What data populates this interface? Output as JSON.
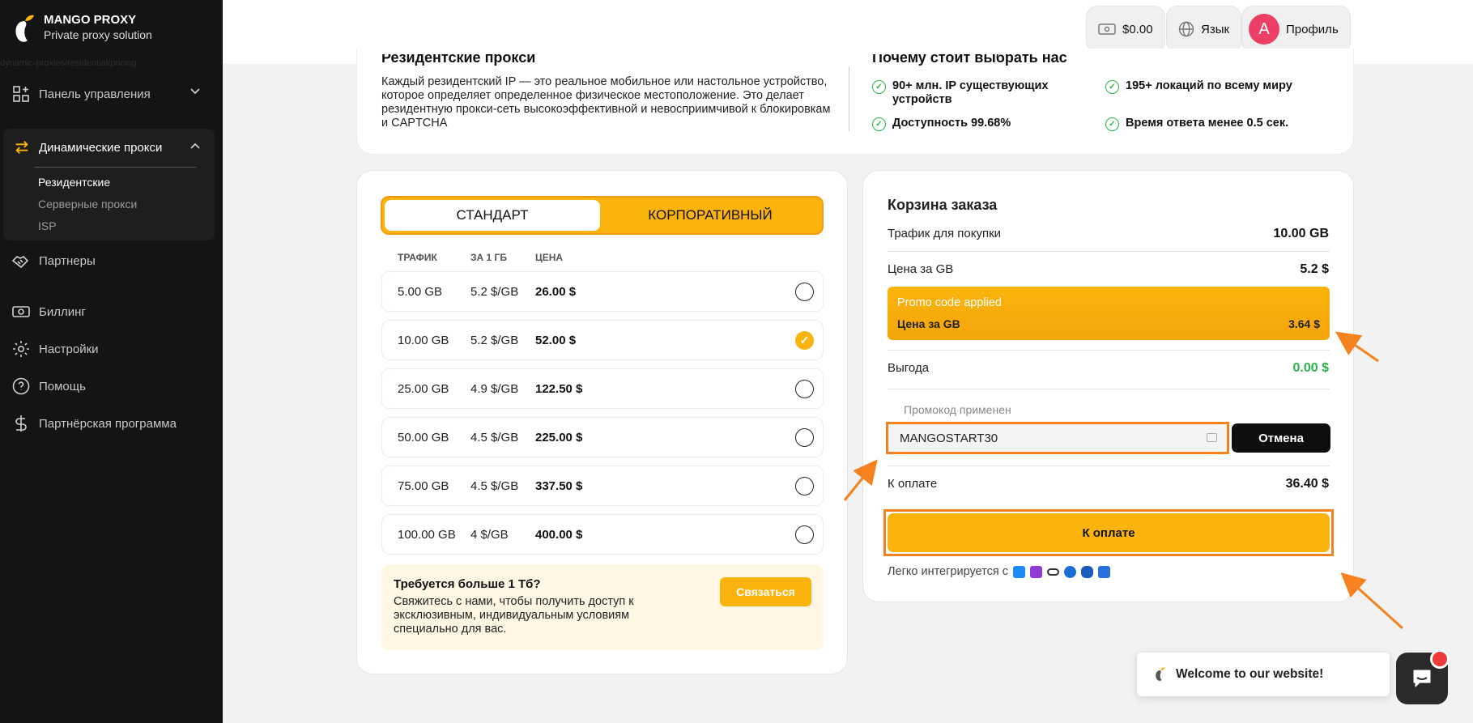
{
  "brand": {
    "name": "MANGO PROXY",
    "tagline": "Private proxy solution",
    "url_ghost": "dynamic-proxies/residential/pricing"
  },
  "sidebar": {
    "dashboard": "Панель управления",
    "dynamic_group": {
      "label": "Динамические прокси",
      "items": [
        "Резидентские",
        "Серверные прокси",
        "ISP"
      ]
    },
    "partners": "Партнеры",
    "billing": "Биллинг",
    "settings": "Настройки",
    "help": "Помощь",
    "affiliate": "Партнёрская программа"
  },
  "topbar": {
    "balance": "$0.00",
    "language": "Язык",
    "avatar_letter": "A",
    "profile": "Профиль"
  },
  "info": {
    "title_left": "Резидентские прокси",
    "title_right": "Почему стоит выбрать нас",
    "description": "Каждый резидентский IP — это реальное мобильное или настольное устройство, которое определяет определенное физическое местоположение. Это делает резидентную прокси-сеть высокоэффективной и невосприимчивой к блокировкам и CAPTCHA",
    "features": [
      "90+ млн. IP существующих устройств",
      "195+ локаций по всему миру",
      "Доступность 99.68%",
      "Время ответа менее 0.5 сек."
    ]
  },
  "plans": {
    "tab_standard": "СТАНДАРТ",
    "tab_corporate": "КОРПОРАТИВНЫЙ",
    "headers": {
      "traffic": "ТРАФИК",
      "per_gb": "ЗА 1 ГБ",
      "price": "ЦЕНА"
    },
    "rows": [
      {
        "traffic": "5.00 GB",
        "per_gb": "5.2 $/GB",
        "price": "26.00 $",
        "selected": false
      },
      {
        "traffic": "10.00 GB",
        "per_gb": "5.2 $/GB",
        "price": "52.00 $",
        "selected": true
      },
      {
        "traffic": "25.00 GB",
        "per_gb": "4.9 $/GB",
        "price": "122.50 $",
        "selected": false
      },
      {
        "traffic": "50.00 GB",
        "per_gb": "4.5 $/GB",
        "price": "225.00 $",
        "selected": false
      },
      {
        "traffic": "75.00 GB",
        "per_gb": "4.5 $/GB",
        "price": "337.50 $",
        "selected": false
      },
      {
        "traffic": "100.00 GB",
        "per_gb": "4 $/GB",
        "price": "400.00 $",
        "selected": false
      }
    ],
    "cta": {
      "title": "Требуется больше 1 Тб?",
      "text": "Свяжитесь с нами, чтобы получить доступ к эксклюзивным, индивидуальным условиям специально для вас.",
      "button": "Связаться"
    }
  },
  "cart": {
    "title": "Корзина заказа",
    "traffic_label": "Трафик для покупки",
    "traffic_value": "10.00 GB",
    "price_label": "Цена за GB",
    "price_value": "5.2 $",
    "promo_applied": "Promo code applied",
    "promo_price_label": "Цена за GB",
    "promo_price_value": "3.64 $",
    "savings_label": "Выгода",
    "savings_value": "0.00 $",
    "promo_field_label": "Промокод применен",
    "promo_code": "MANGOSTART30",
    "cancel": "Отмена",
    "total_label": "К оплате",
    "total_value": "36.40 $",
    "pay_button": "К оплате",
    "integrates": "Легко интегрируется с",
    "integration_icons": [
      "telegram-icon",
      "video-icon",
      "infinity-icon",
      "person-icon",
      "bug-icon",
      "x-icon"
    ]
  },
  "chat": {
    "welcome": "Welcome to our website!"
  },
  "colors": {
    "accent": "#fbb40d",
    "highlight_frame": "#f5821f",
    "success": "#2bb24c",
    "sidebar_bg": "#141414",
    "avatar": "#ec3f66"
  }
}
